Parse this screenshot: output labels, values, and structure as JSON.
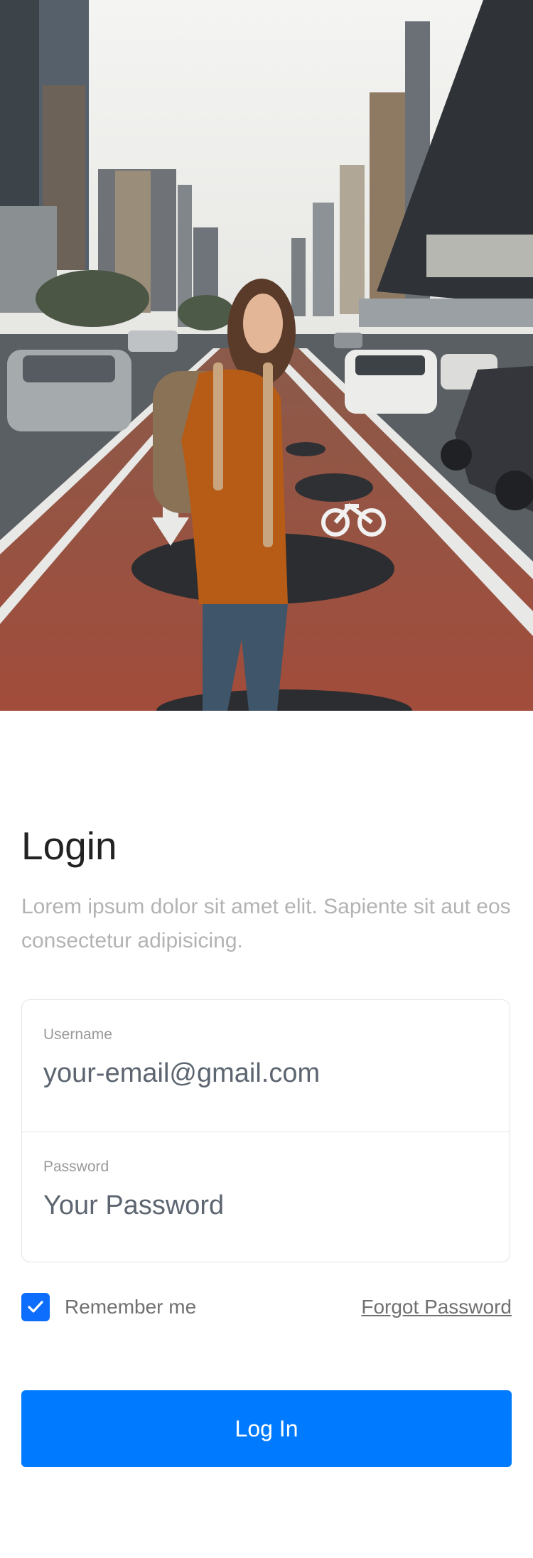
{
  "login": {
    "title": "Login",
    "subtitle": "Lorem ipsum dolor sit amet elit. Sapiente sit aut eos consectetur adipisicing.",
    "username": {
      "label": "Username",
      "placeholder": "your-email@gmail.com"
    },
    "password": {
      "label": "Password",
      "placeholder": "Your Password"
    },
    "remember_label": "Remember me",
    "remember_checked": true,
    "forgot_label": "Forgot Password",
    "submit_label": "Log In"
  },
  "colors": {
    "accent": "#007bff",
    "checkbox": "#0d6efd",
    "title": "#222222",
    "muted": "#b3b3b3"
  },
  "icons": {
    "checkbox": "check-icon"
  }
}
